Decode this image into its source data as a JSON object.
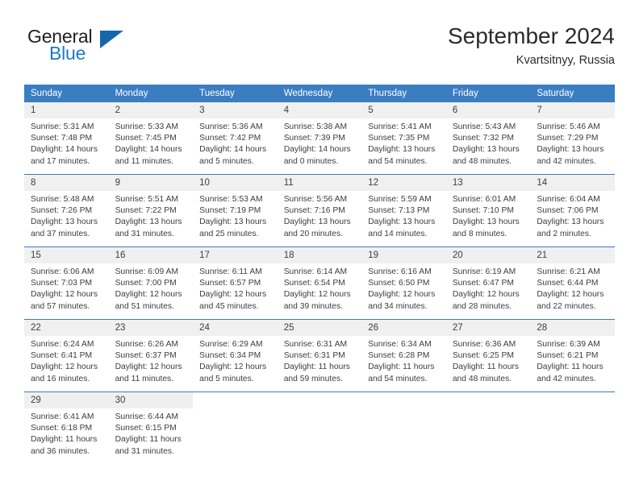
{
  "brand": {
    "name_top": "General",
    "name_bottom": "Blue",
    "accent_color": "#1f7ac4",
    "triangle_color": "#1566ad"
  },
  "header": {
    "title": "September 2024",
    "subtitle": "Kvartsitnyy, Russia"
  },
  "theme": {
    "header_row_bg": "#3a7dc1",
    "daynum_bg": "#f0f0f0",
    "text_color": "#3d3d3d",
    "row_divider": "#3a7dc1"
  },
  "weekday_headers": [
    "Sunday",
    "Monday",
    "Tuesday",
    "Wednesday",
    "Thursday",
    "Friday",
    "Saturday"
  ],
  "labels": {
    "sunrise_prefix": "Sunrise:",
    "sunset_prefix": "Sunset:",
    "daylight_prefix": "Daylight:"
  },
  "weeks": [
    [
      {
        "day": "1",
        "sunrise": "Sunrise: 5:31 AM",
        "sunset": "Sunset: 7:48 PM",
        "daylight_line1": "Daylight: 14 hours",
        "daylight_line2": "and 17 minutes."
      },
      {
        "day": "2",
        "sunrise": "Sunrise: 5:33 AM",
        "sunset": "Sunset: 7:45 PM",
        "daylight_line1": "Daylight: 14 hours",
        "daylight_line2": "and 11 minutes."
      },
      {
        "day": "3",
        "sunrise": "Sunrise: 5:36 AM",
        "sunset": "Sunset: 7:42 PM",
        "daylight_line1": "Daylight: 14 hours",
        "daylight_line2": "and 5 minutes."
      },
      {
        "day": "4",
        "sunrise": "Sunrise: 5:38 AM",
        "sunset": "Sunset: 7:39 PM",
        "daylight_line1": "Daylight: 14 hours",
        "daylight_line2": "and 0 minutes."
      },
      {
        "day": "5",
        "sunrise": "Sunrise: 5:41 AM",
        "sunset": "Sunset: 7:35 PM",
        "daylight_line1": "Daylight: 13 hours",
        "daylight_line2": "and 54 minutes."
      },
      {
        "day": "6",
        "sunrise": "Sunrise: 5:43 AM",
        "sunset": "Sunset: 7:32 PM",
        "daylight_line1": "Daylight: 13 hours",
        "daylight_line2": "and 48 minutes."
      },
      {
        "day": "7",
        "sunrise": "Sunrise: 5:46 AM",
        "sunset": "Sunset: 7:29 PM",
        "daylight_line1": "Daylight: 13 hours",
        "daylight_line2": "and 42 minutes."
      }
    ],
    [
      {
        "day": "8",
        "sunrise": "Sunrise: 5:48 AM",
        "sunset": "Sunset: 7:26 PM",
        "daylight_line1": "Daylight: 13 hours",
        "daylight_line2": "and 37 minutes."
      },
      {
        "day": "9",
        "sunrise": "Sunrise: 5:51 AM",
        "sunset": "Sunset: 7:22 PM",
        "daylight_line1": "Daylight: 13 hours",
        "daylight_line2": "and 31 minutes."
      },
      {
        "day": "10",
        "sunrise": "Sunrise: 5:53 AM",
        "sunset": "Sunset: 7:19 PM",
        "daylight_line1": "Daylight: 13 hours",
        "daylight_line2": "and 25 minutes."
      },
      {
        "day": "11",
        "sunrise": "Sunrise: 5:56 AM",
        "sunset": "Sunset: 7:16 PM",
        "daylight_line1": "Daylight: 13 hours",
        "daylight_line2": "and 20 minutes."
      },
      {
        "day": "12",
        "sunrise": "Sunrise: 5:59 AM",
        "sunset": "Sunset: 7:13 PM",
        "daylight_line1": "Daylight: 13 hours",
        "daylight_line2": "and 14 minutes."
      },
      {
        "day": "13",
        "sunrise": "Sunrise: 6:01 AM",
        "sunset": "Sunset: 7:10 PM",
        "daylight_line1": "Daylight: 13 hours",
        "daylight_line2": "and 8 minutes."
      },
      {
        "day": "14",
        "sunrise": "Sunrise: 6:04 AM",
        "sunset": "Sunset: 7:06 PM",
        "daylight_line1": "Daylight: 13 hours",
        "daylight_line2": "and 2 minutes."
      }
    ],
    [
      {
        "day": "15",
        "sunrise": "Sunrise: 6:06 AM",
        "sunset": "Sunset: 7:03 PM",
        "daylight_line1": "Daylight: 12 hours",
        "daylight_line2": "and 57 minutes."
      },
      {
        "day": "16",
        "sunrise": "Sunrise: 6:09 AM",
        "sunset": "Sunset: 7:00 PM",
        "daylight_line1": "Daylight: 12 hours",
        "daylight_line2": "and 51 minutes."
      },
      {
        "day": "17",
        "sunrise": "Sunrise: 6:11 AM",
        "sunset": "Sunset: 6:57 PM",
        "daylight_line1": "Daylight: 12 hours",
        "daylight_line2": "and 45 minutes."
      },
      {
        "day": "18",
        "sunrise": "Sunrise: 6:14 AM",
        "sunset": "Sunset: 6:54 PM",
        "daylight_line1": "Daylight: 12 hours",
        "daylight_line2": "and 39 minutes."
      },
      {
        "day": "19",
        "sunrise": "Sunrise: 6:16 AM",
        "sunset": "Sunset: 6:50 PM",
        "daylight_line1": "Daylight: 12 hours",
        "daylight_line2": "and 34 minutes."
      },
      {
        "day": "20",
        "sunrise": "Sunrise: 6:19 AM",
        "sunset": "Sunset: 6:47 PM",
        "daylight_line1": "Daylight: 12 hours",
        "daylight_line2": "and 28 minutes."
      },
      {
        "day": "21",
        "sunrise": "Sunrise: 6:21 AM",
        "sunset": "Sunset: 6:44 PM",
        "daylight_line1": "Daylight: 12 hours",
        "daylight_line2": "and 22 minutes."
      }
    ],
    [
      {
        "day": "22",
        "sunrise": "Sunrise: 6:24 AM",
        "sunset": "Sunset: 6:41 PM",
        "daylight_line1": "Daylight: 12 hours",
        "daylight_line2": "and 16 minutes."
      },
      {
        "day": "23",
        "sunrise": "Sunrise: 6:26 AM",
        "sunset": "Sunset: 6:37 PM",
        "daylight_line1": "Daylight: 12 hours",
        "daylight_line2": "and 11 minutes."
      },
      {
        "day": "24",
        "sunrise": "Sunrise: 6:29 AM",
        "sunset": "Sunset: 6:34 PM",
        "daylight_line1": "Daylight: 12 hours",
        "daylight_line2": "and 5 minutes."
      },
      {
        "day": "25",
        "sunrise": "Sunrise: 6:31 AM",
        "sunset": "Sunset: 6:31 PM",
        "daylight_line1": "Daylight: 11 hours",
        "daylight_line2": "and 59 minutes."
      },
      {
        "day": "26",
        "sunrise": "Sunrise: 6:34 AM",
        "sunset": "Sunset: 6:28 PM",
        "daylight_line1": "Daylight: 11 hours",
        "daylight_line2": "and 54 minutes."
      },
      {
        "day": "27",
        "sunrise": "Sunrise: 6:36 AM",
        "sunset": "Sunset: 6:25 PM",
        "daylight_line1": "Daylight: 11 hours",
        "daylight_line2": "and 48 minutes."
      },
      {
        "day": "28",
        "sunrise": "Sunrise: 6:39 AM",
        "sunset": "Sunset: 6:21 PM",
        "daylight_line1": "Daylight: 11 hours",
        "daylight_line2": "and 42 minutes."
      }
    ],
    [
      {
        "day": "29",
        "sunrise": "Sunrise: 6:41 AM",
        "sunset": "Sunset: 6:18 PM",
        "daylight_line1": "Daylight: 11 hours",
        "daylight_line2": "and 36 minutes."
      },
      {
        "day": "30",
        "sunrise": "Sunrise: 6:44 AM",
        "sunset": "Sunset: 6:15 PM",
        "daylight_line1": "Daylight: 11 hours",
        "daylight_line2": "and 31 minutes."
      },
      {
        "day": "",
        "sunrise": "",
        "sunset": "",
        "daylight_line1": "",
        "daylight_line2": ""
      },
      {
        "day": "",
        "sunrise": "",
        "sunset": "",
        "daylight_line1": "",
        "daylight_line2": ""
      },
      {
        "day": "",
        "sunrise": "",
        "sunset": "",
        "daylight_line1": "",
        "daylight_line2": ""
      },
      {
        "day": "",
        "sunrise": "",
        "sunset": "",
        "daylight_line1": "",
        "daylight_line2": ""
      },
      {
        "day": "",
        "sunrise": "",
        "sunset": "",
        "daylight_line1": "",
        "daylight_line2": ""
      }
    ]
  ]
}
